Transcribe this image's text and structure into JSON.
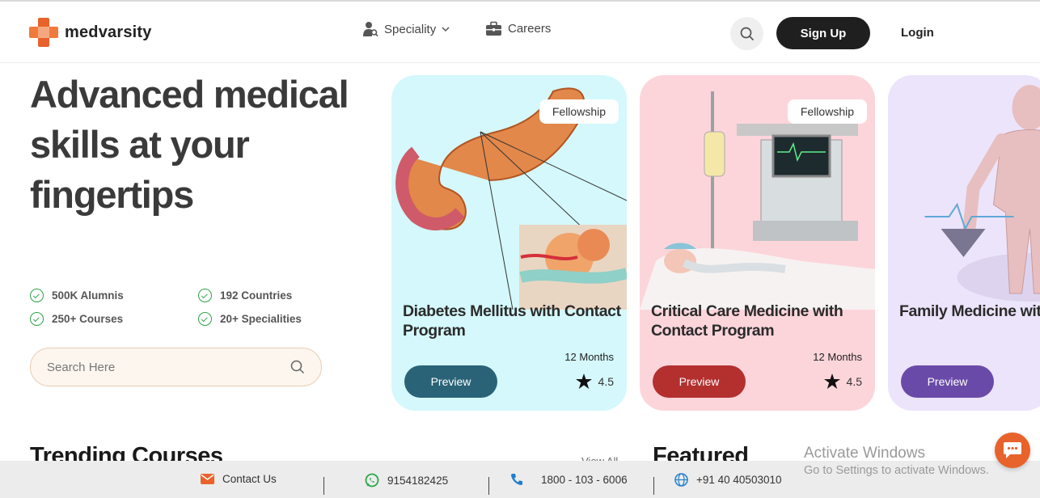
{
  "brand": {
    "name": "medvarsity"
  },
  "nav": {
    "speciality": "Speciality",
    "careers": "Careers"
  },
  "header": {
    "signup": "Sign Up",
    "login": "Login"
  },
  "hero": {
    "headline": "Advanced medical skills at your fingertips",
    "stats": [
      "500K Alumnis",
      "192 Countries",
      "250+ Courses",
      "20+ Specialities"
    ],
    "search_placeholder": "Search Here"
  },
  "courses": [
    {
      "badge": "Fellowship",
      "title": "Diabetes Mellitus with Contact Program",
      "duration": "12 Months",
      "rating": "4.5",
      "cta": "Preview",
      "color": "#d4f8fb"
    },
    {
      "badge": "Fellowship",
      "title": "Critical Care Medicine with Contact Program",
      "duration": "12 Months",
      "rating": "4.5",
      "cta": "Preview",
      "color": "#fcd5db"
    },
    {
      "title": "Family Medicine with Contact Program",
      "cta": "Preview",
      "color": "#ece4fb"
    }
  ],
  "sections": {
    "trending": "Trending Courses",
    "view_all": "View All",
    "featured": "Featured"
  },
  "footer": {
    "contact": "Contact Us",
    "whatsapp": "9154182425",
    "phone": "1800 - 103 - 6006",
    "intl": "+91 40 40503010"
  },
  "watermark": {
    "line1": "Activate Windows",
    "line2": "Go to Settings to activate Windows."
  },
  "colors": {
    "brand": "#e8632b",
    "check": "#2ea34a"
  }
}
